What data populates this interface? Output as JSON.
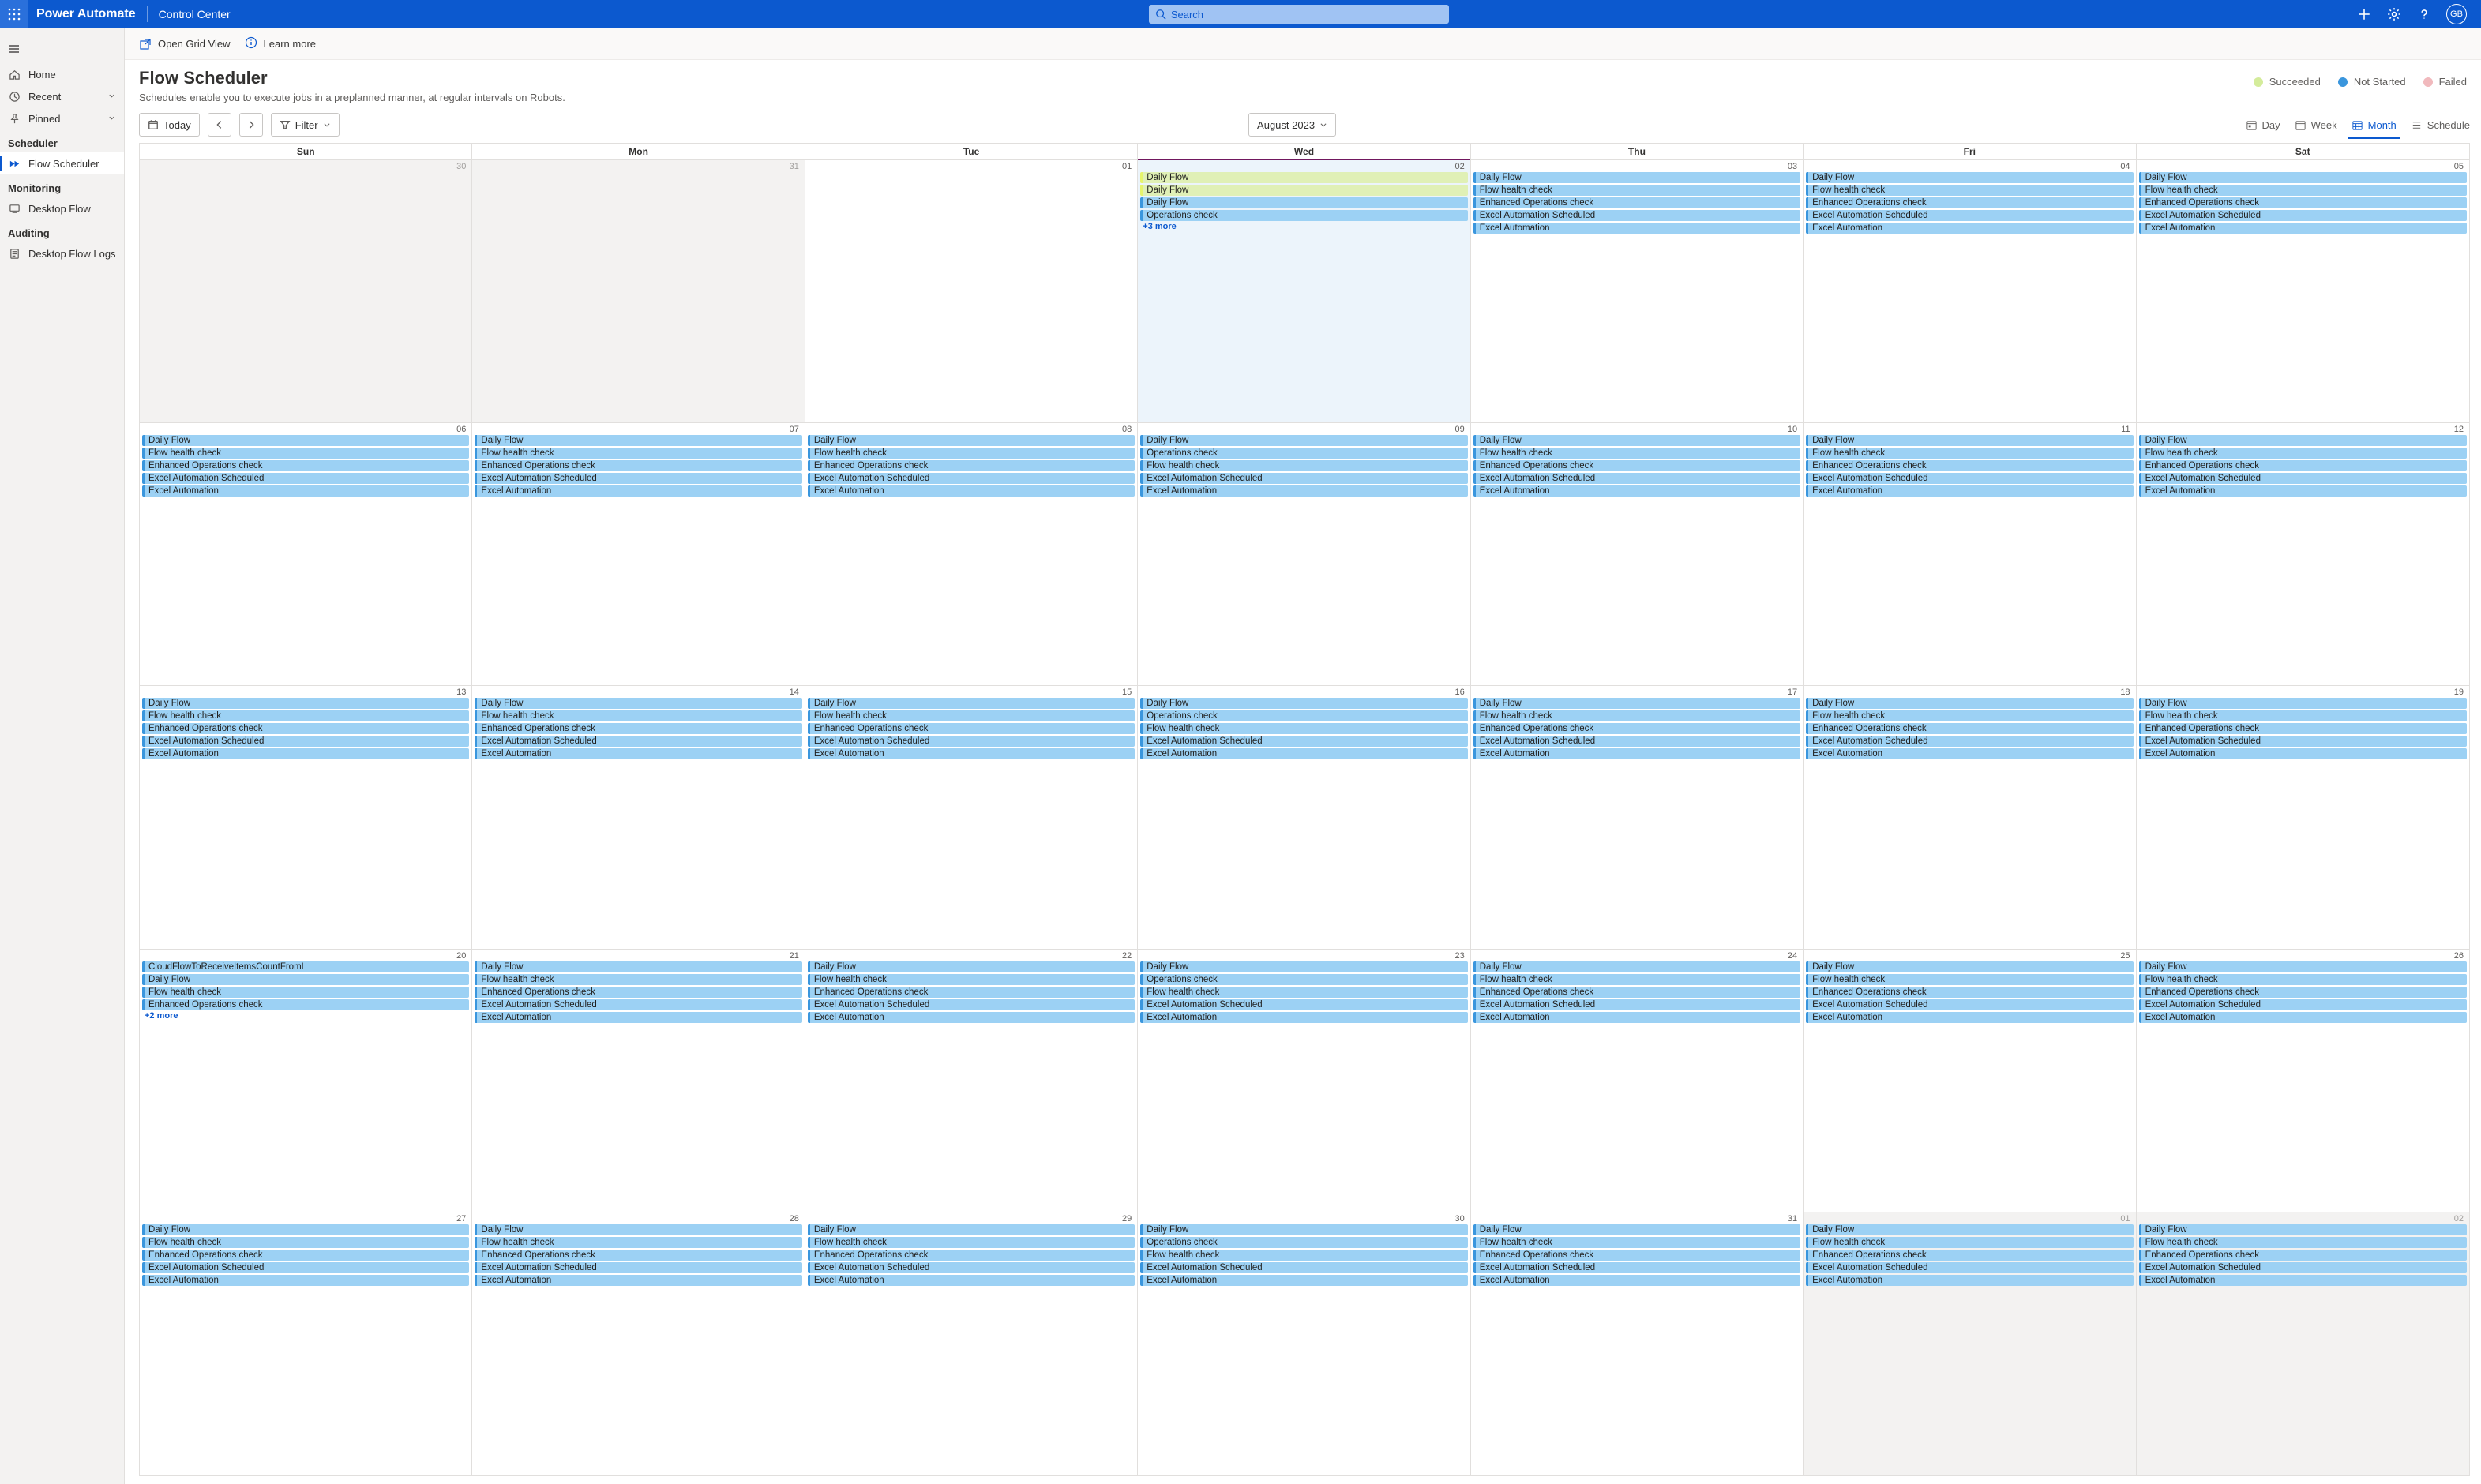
{
  "header": {
    "brand": "Power Automate",
    "breadcrumb": "Control Center",
    "search_placeholder": "Search",
    "avatar_initials": "GB"
  },
  "sidebar": {
    "primary": [
      {
        "icon": "home",
        "label": "Home"
      },
      {
        "icon": "clock",
        "label": "Recent",
        "chevron": true
      },
      {
        "icon": "pin",
        "label": "Pinned",
        "chevron": true
      }
    ],
    "sections": [
      {
        "title": "Scheduler",
        "items": [
          {
            "icon": "flow",
            "label": "Flow Scheduler",
            "selected": true
          }
        ]
      },
      {
        "title": "Monitoring",
        "items": [
          {
            "icon": "desktop",
            "label": "Desktop Flow"
          }
        ]
      },
      {
        "title": "Auditing",
        "items": [
          {
            "icon": "logs",
            "label": "Desktop Flow Logs"
          }
        ]
      }
    ]
  },
  "ribbon": {
    "open_grid": "Open Grid View",
    "learn_more": "Learn more"
  },
  "page": {
    "title": "Flow Scheduler",
    "subtitle": "Schedules enable you to execute jobs in a preplanned manner, at regular intervals on Robots."
  },
  "legend": [
    {
      "key": "succeeded",
      "label": "Succeeded",
      "color": "#d4ec9b"
    },
    {
      "key": "notstarted",
      "label": "Not Started",
      "color": "#3a96dd"
    },
    {
      "key": "failed",
      "label": "Failed",
      "color": "#f1b9bd"
    }
  ],
  "toolbar": {
    "today": "Today",
    "filter": "Filter",
    "month_label": "August 2023",
    "views": {
      "day": "Day",
      "week": "Week",
      "month": "Month",
      "schedule": "Schedule"
    }
  },
  "calendar": {
    "day_headers": [
      "Sun",
      "Mon",
      "Tue",
      "Wed",
      "Thu",
      "Fri",
      "Sat"
    ],
    "today_col": 3,
    "weeks": [
      [
        {
          "num": "30",
          "other": true,
          "events": []
        },
        {
          "num": "31",
          "other": true,
          "events": []
        },
        {
          "num": "01",
          "events": []
        },
        {
          "num": "02",
          "today": true,
          "more": "+3 more",
          "events": [
            {
              "t": "Daily Flow",
              "s": "succ"
            },
            {
              "t": "Daily Flow",
              "s": "succ"
            },
            {
              "t": "Daily Flow"
            },
            {
              "t": "Operations check"
            }
          ]
        },
        {
          "num": "03",
          "events": [
            {
              "t": "Daily Flow"
            },
            {
              "t": "Flow health check"
            },
            {
              "t": "Enhanced Operations check"
            },
            {
              "t": "Excel Automation Scheduled"
            },
            {
              "t": "Excel Automation"
            }
          ]
        },
        {
          "num": "04",
          "events": [
            {
              "t": "Daily Flow"
            },
            {
              "t": "Flow health check"
            },
            {
              "t": "Enhanced Operations check"
            },
            {
              "t": "Excel Automation Scheduled"
            },
            {
              "t": "Excel Automation"
            }
          ]
        },
        {
          "num": "05",
          "events": [
            {
              "t": "Daily Flow"
            },
            {
              "t": "Flow health check"
            },
            {
              "t": "Enhanced Operations check"
            },
            {
              "t": "Excel Automation Scheduled"
            },
            {
              "t": "Excel Automation"
            }
          ]
        }
      ],
      [
        {
          "num": "06",
          "events": [
            {
              "t": "Daily Flow"
            },
            {
              "t": "Flow health check"
            },
            {
              "t": "Enhanced Operations check"
            },
            {
              "t": "Excel Automation Scheduled"
            },
            {
              "t": "Excel Automation"
            }
          ]
        },
        {
          "num": "07",
          "events": [
            {
              "t": "Daily Flow"
            },
            {
              "t": "Flow health check"
            },
            {
              "t": "Enhanced Operations check"
            },
            {
              "t": "Excel Automation Scheduled"
            },
            {
              "t": "Excel Automation"
            }
          ]
        },
        {
          "num": "08",
          "events": [
            {
              "t": "Daily Flow"
            },
            {
              "t": "Flow health check"
            },
            {
              "t": "Enhanced Operations check"
            },
            {
              "t": "Excel Automation Scheduled"
            },
            {
              "t": "Excel Automation"
            }
          ]
        },
        {
          "num": "09",
          "events": [
            {
              "t": "Daily Flow"
            },
            {
              "t": "Operations check"
            },
            {
              "t": "Flow health check"
            },
            {
              "t": "Excel Automation Scheduled"
            },
            {
              "t": "Excel Automation"
            }
          ]
        },
        {
          "num": "10",
          "events": [
            {
              "t": "Daily Flow"
            },
            {
              "t": "Flow health check"
            },
            {
              "t": "Enhanced Operations check"
            },
            {
              "t": "Excel Automation Scheduled"
            },
            {
              "t": "Excel Automation"
            }
          ]
        },
        {
          "num": "11",
          "events": [
            {
              "t": "Daily Flow"
            },
            {
              "t": "Flow health check"
            },
            {
              "t": "Enhanced Operations check"
            },
            {
              "t": "Excel Automation Scheduled"
            },
            {
              "t": "Excel Automation"
            }
          ]
        },
        {
          "num": "12",
          "events": [
            {
              "t": "Daily Flow"
            },
            {
              "t": "Flow health check"
            },
            {
              "t": "Enhanced Operations check"
            },
            {
              "t": "Excel Automation Scheduled"
            },
            {
              "t": "Excel Automation"
            }
          ]
        }
      ],
      [
        {
          "num": "13",
          "events": [
            {
              "t": "Daily Flow"
            },
            {
              "t": "Flow health check"
            },
            {
              "t": "Enhanced Operations check"
            },
            {
              "t": "Excel Automation Scheduled"
            },
            {
              "t": "Excel Automation"
            }
          ]
        },
        {
          "num": "14",
          "events": [
            {
              "t": "Daily Flow"
            },
            {
              "t": "Flow health check"
            },
            {
              "t": "Enhanced Operations check"
            },
            {
              "t": "Excel Automation Scheduled"
            },
            {
              "t": "Excel Automation"
            }
          ]
        },
        {
          "num": "15",
          "events": [
            {
              "t": "Daily Flow"
            },
            {
              "t": "Flow health check"
            },
            {
              "t": "Enhanced Operations check"
            },
            {
              "t": "Excel Automation Scheduled"
            },
            {
              "t": "Excel Automation"
            }
          ]
        },
        {
          "num": "16",
          "events": [
            {
              "t": "Daily Flow"
            },
            {
              "t": "Operations check"
            },
            {
              "t": "Flow health check"
            },
            {
              "t": "Excel Automation Scheduled"
            },
            {
              "t": "Excel Automation"
            }
          ]
        },
        {
          "num": "17",
          "events": [
            {
              "t": "Daily Flow"
            },
            {
              "t": "Flow health check"
            },
            {
              "t": "Enhanced Operations check"
            },
            {
              "t": "Excel Automation Scheduled"
            },
            {
              "t": "Excel Automation"
            }
          ]
        },
        {
          "num": "18",
          "events": [
            {
              "t": "Daily Flow"
            },
            {
              "t": "Flow health check"
            },
            {
              "t": "Enhanced Operations check"
            },
            {
              "t": "Excel Automation Scheduled"
            },
            {
              "t": "Excel Automation"
            }
          ]
        },
        {
          "num": "19",
          "events": [
            {
              "t": "Daily Flow"
            },
            {
              "t": "Flow health check"
            },
            {
              "t": "Enhanced Operations check"
            },
            {
              "t": "Excel Automation Scheduled"
            },
            {
              "t": "Excel Automation"
            }
          ]
        }
      ],
      [
        {
          "num": "20",
          "more": "+2 more",
          "events": [
            {
              "t": "CloudFlowToReceiveItemsCountFromL"
            },
            {
              "t": "Daily Flow"
            },
            {
              "t": "Flow health check"
            },
            {
              "t": "Enhanced Operations check"
            }
          ]
        },
        {
          "num": "21",
          "events": [
            {
              "t": "Daily Flow"
            },
            {
              "t": "Flow health check"
            },
            {
              "t": "Enhanced Operations check"
            },
            {
              "t": "Excel Automation Scheduled"
            },
            {
              "t": "Excel Automation"
            }
          ]
        },
        {
          "num": "22",
          "events": [
            {
              "t": "Daily Flow"
            },
            {
              "t": "Flow health check"
            },
            {
              "t": "Enhanced Operations check"
            },
            {
              "t": "Excel Automation Scheduled"
            },
            {
              "t": "Excel Automation"
            }
          ]
        },
        {
          "num": "23",
          "events": [
            {
              "t": "Daily Flow"
            },
            {
              "t": "Operations check"
            },
            {
              "t": "Flow health check"
            },
            {
              "t": "Excel Automation Scheduled"
            },
            {
              "t": "Excel Automation"
            }
          ]
        },
        {
          "num": "24",
          "events": [
            {
              "t": "Daily Flow"
            },
            {
              "t": "Flow health check"
            },
            {
              "t": "Enhanced Operations check"
            },
            {
              "t": "Excel Automation Scheduled"
            },
            {
              "t": "Excel Automation"
            }
          ]
        },
        {
          "num": "25",
          "events": [
            {
              "t": "Daily Flow"
            },
            {
              "t": "Flow health check"
            },
            {
              "t": "Enhanced Operations check"
            },
            {
              "t": "Excel Automation Scheduled"
            },
            {
              "t": "Excel Automation"
            }
          ]
        },
        {
          "num": "26",
          "events": [
            {
              "t": "Daily Flow"
            },
            {
              "t": "Flow health check"
            },
            {
              "t": "Enhanced Operations check"
            },
            {
              "t": "Excel Automation Scheduled"
            },
            {
              "t": "Excel Automation"
            }
          ]
        }
      ],
      [
        {
          "num": "27",
          "events": [
            {
              "t": "Daily Flow"
            },
            {
              "t": "Flow health check"
            },
            {
              "t": "Enhanced Operations check"
            },
            {
              "t": "Excel Automation Scheduled"
            },
            {
              "t": "Excel Automation"
            }
          ]
        },
        {
          "num": "28",
          "events": [
            {
              "t": "Daily Flow"
            },
            {
              "t": "Flow health check"
            },
            {
              "t": "Enhanced Operations check"
            },
            {
              "t": "Excel Automation Scheduled"
            },
            {
              "t": "Excel Automation"
            }
          ]
        },
        {
          "num": "29",
          "events": [
            {
              "t": "Daily Flow"
            },
            {
              "t": "Flow health check"
            },
            {
              "t": "Enhanced Operations check"
            },
            {
              "t": "Excel Automation Scheduled"
            },
            {
              "t": "Excel Automation"
            }
          ]
        },
        {
          "num": "30",
          "events": [
            {
              "t": "Daily Flow"
            },
            {
              "t": "Operations check"
            },
            {
              "t": "Flow health check"
            },
            {
              "t": "Excel Automation Scheduled"
            },
            {
              "t": "Excel Automation"
            }
          ]
        },
        {
          "num": "31",
          "events": [
            {
              "t": "Daily Flow"
            },
            {
              "t": "Flow health check"
            },
            {
              "t": "Enhanced Operations check"
            },
            {
              "t": "Excel Automation Scheduled"
            },
            {
              "t": "Excel Automation"
            }
          ]
        },
        {
          "num": "01",
          "other": true,
          "events": [
            {
              "t": "Daily Flow"
            },
            {
              "t": "Flow health check"
            },
            {
              "t": "Enhanced Operations check"
            },
            {
              "t": "Excel Automation Scheduled"
            },
            {
              "t": "Excel Automation"
            }
          ]
        },
        {
          "num": "02",
          "other": true,
          "events": [
            {
              "t": "Daily Flow"
            },
            {
              "t": "Flow health check"
            },
            {
              "t": "Enhanced Operations check"
            },
            {
              "t": "Excel Automation Scheduled"
            },
            {
              "t": "Excel Automation"
            }
          ]
        }
      ]
    ]
  }
}
